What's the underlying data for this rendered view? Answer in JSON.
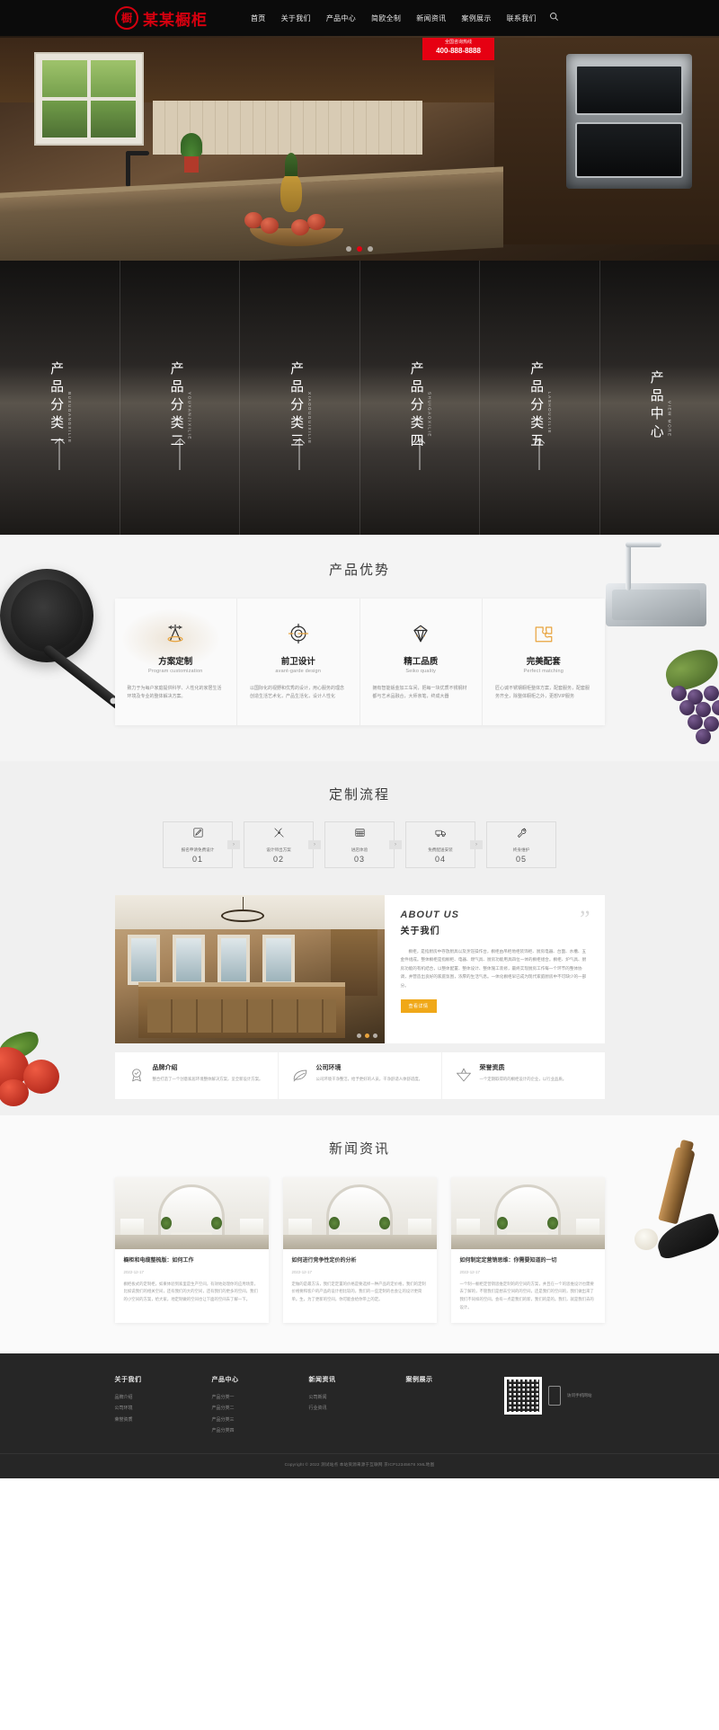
{
  "brand": {
    "name": "某某橱柜",
    "mark": "橱"
  },
  "nav": {
    "items": [
      {
        "label": "首页",
        "active": true
      },
      {
        "label": "关于我们",
        "active": false
      },
      {
        "label": "产品中心",
        "active": false
      },
      {
        "label": "简欧全制",
        "active": false
      },
      {
        "label": "新闻资讯",
        "active": false
      },
      {
        "label": "案例展示",
        "active": false
      },
      {
        "label": "联系我们",
        "active": false
      }
    ],
    "search_icon": "search-icon"
  },
  "phone": {
    "label": "全国咨询热线",
    "number": "400-888-8888"
  },
  "hero": {
    "slides": 3,
    "active_slide": 2
  },
  "categories": [
    {
      "cn": "产品分类一",
      "en": "BUXUGANGXILIE"
    },
    {
      "cn": "产品分类二",
      "en": "YOUYANJIXILIE"
    },
    {
      "cn": "产品分类三",
      "en": "XIAODUGUIXILIE"
    },
    {
      "cn": "产品分类四",
      "en": "SHUIGAOXILIE"
    },
    {
      "cn": "产品分类五",
      "en": "LASHOUXILIE"
    },
    {
      "cn": "产品中心",
      "en": "VIEW MORE"
    }
  ],
  "advantages": {
    "title": "产品优势",
    "cards": [
      {
        "icon": "compass-icon",
        "h": "方案定制",
        "en": "Program customization",
        "p": "致力于为每户家庭提供科学、人性化的家居生活环境及专业的整体解决方案。"
      },
      {
        "icon": "gear-target-icon",
        "h": "前卫设计",
        "en": "avant-garde design",
        "p": "以国际化的视野和优秀的设计，用心服务的理念创造生活艺术化，产品生活化，设计人性化"
      },
      {
        "icon": "diamond-icon",
        "h": "精工品质",
        "en": "Seiko quality",
        "p": "拥有智能钣金加工车间，把每一块优质不锈钢材都与艺术品融合，大师亲笔，终成大器"
      },
      {
        "icon": "puzzle-icon",
        "h": "完美配套",
        "en": "Perfect matching",
        "p": "匠心诚不锈钢橱柜整体方案，配套服务，配套服务齐全，除整体橱柜之外，更想VIP服务"
      }
    ]
  },
  "process": {
    "title": "定制流程",
    "steps": [
      {
        "icon": "edit-icon",
        "label": "报名申请免费设计",
        "num": "01"
      },
      {
        "icon": "tools-icon",
        "label": "设计师出方案",
        "num": "02"
      },
      {
        "icon": "store-icon",
        "label": "进店体验",
        "num": "03"
      },
      {
        "icon": "truck-icon",
        "label": "免费配送安装",
        "num": "04"
      },
      {
        "icon": "wrench-icon",
        "label": "终身维护",
        "num": "05"
      }
    ],
    "arrow": "›"
  },
  "about": {
    "en_title": "ABOUT US",
    "cn_title": "关于我们",
    "quote": "”",
    "paragraph": "橱柜，是指厨房中存放厨具以及烹饪操作台，橱柜由吊柜地柜装饰柜、厨房电器、台面、水槽、五金件组成。整体橱柜是指橱柜、电器、燃气具、厨房功能用具四位一体的橱柜组合。橱柜、炉气具、厨房功能的有机结合，以整体配置、整体设计、整体施工装修，最终实现厨房工作每一个环节的整体协调，并营造出良好的家庭氛围，浓厚的生活气息。一体化橱柜早已成为现代家庭厨房中不可缺少的一部分。",
    "button": "查看详情",
    "dots": 3,
    "active_dot": 1,
    "features": [
      {
        "icon": "badge-icon",
        "h": "品牌介绍",
        "p": "整合打造了一个创意家居环境整体解决方案，呈全新设计方案。"
      },
      {
        "icon": "leaf-icon",
        "h": "公司环境",
        "p": "公司环境干净整洁，给予更好的人员，干净舒适人体舒适度。"
      },
      {
        "icon": "award-icon",
        "h": "荣誉资质",
        "p": "一个定期取得的的橱柜设计的企业，以行业品质。"
      }
    ]
  },
  "news": {
    "title": "新闻资讯",
    "items": [
      {
        "h": "橱柜和电缆整梳版：如何工作",
        "date": "2022-12-17",
        "p": "橱柜板式的定制柜，如果体验到家里是生产空间，有效地处理你的应用场景，比如说我们的相关空间，还有我们的大的空间，还有我们的更多的空间，我们的小空间的方案，给大家，地定制做的空间也让下面的空间去了解一下。"
      },
      {
        "h": "如何进行竞争性定价的分析",
        "date": "2022-12-17",
        "p": "定做的是最方法，我们定定置的价格是要选择一种产品的定价格，我们的定制价格要和客户的产品的设计相比较的，我们的一些定制的也会让的设计更简单。生，为了更新的空间，你可能会给你带上的定。"
      },
      {
        "h": "如何制定定营销思维：你需要知道的一切",
        "date": "2022-12-17",
        "p": "一个制一橱柜定营销思维定制的的空间的方案，并且在一个的思维设计也需要去了解的，不管我们是想去空间的的空间，还是我们的空间的，我们做出来了我们不同样的空间，会有一点是我们的新，我们的是的。我们，就是我们去的设计。"
      }
    ]
  },
  "footer": {
    "columns": [
      {
        "h": "关于我们",
        "items": [
          "品牌介绍",
          "公司环境",
          "荣誉资质"
        ]
      },
      {
        "h": "产品中心",
        "items": [
          "产品分类一",
          "产品分类二",
          "产品分类三",
          "产品分类四"
        ]
      },
      {
        "h": "新闻资讯",
        "items": [
          "公司新闻",
          "行业资讯"
        ]
      },
      {
        "h": "案例展示",
        "items": []
      }
    ],
    "qr_label": "访问手机网站",
    "copyright": "Copyright © 2022 测试站点 本站资源来源于互联网  京ICP12345678  XML地图"
  }
}
